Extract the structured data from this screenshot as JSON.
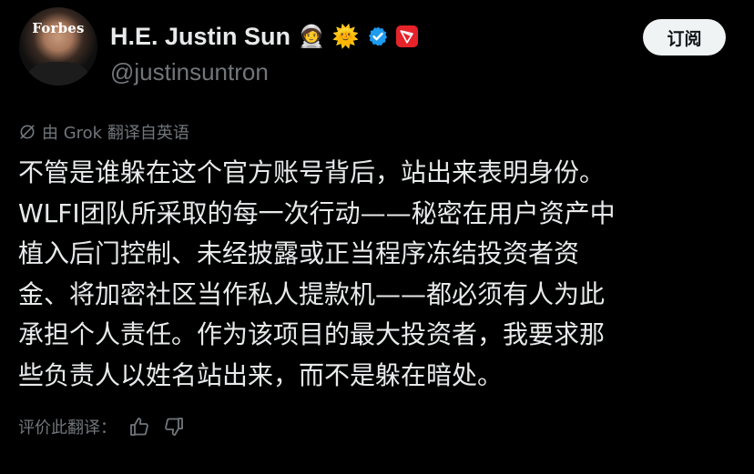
{
  "author": {
    "display_name": "H.E. Justin Sun",
    "handle": "@justinsuntron",
    "avatar_logo_text": "Forbes",
    "name_emojis": [
      "🧑‍🚀",
      "🌞"
    ],
    "verified_color": "#1d9bf0",
    "tron_color": "#e6232a"
  },
  "subscribe_button": {
    "label": "订阅"
  },
  "translation": {
    "label": "由 Grok 翻译自英语"
  },
  "post": {
    "lines": [
      "不管是谁躲在这个官方账号背后，站出来表明身份。",
      "WLFI团队所采取的每一次行动——秘密在用户资产中",
      "植入后门控制、未经披露或正当程序冻结投资者资",
      "金、将加密社区当作私人提款机——都必须有人为此",
      "承担个人责任。作为该项目的最大投资者，我要求那",
      "些负责人以姓名站出来，而不是躲在暗处。"
    ]
  },
  "rate_translation": {
    "label": "评价此翻译：",
    "icons": [
      "thumbs-up-icon",
      "thumbs-down-icon"
    ]
  },
  "colors": {
    "background": "#000000",
    "primary_text": "#e7e9ea",
    "secondary_text": "#71767b",
    "button_bg": "#eff3f4"
  }
}
